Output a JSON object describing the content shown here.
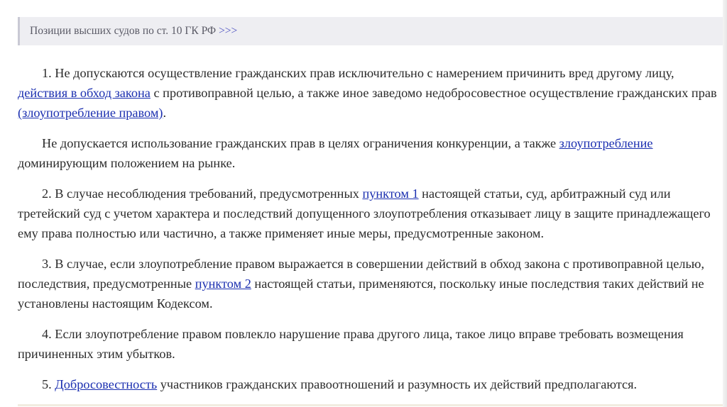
{
  "header": {
    "title": "Позиции высших судов по ст. 10 ГК РФ",
    "link": ">>>"
  },
  "paragraphs": [
    {
      "t1": "1. Не допускаются осуществление гражданских прав исключительно с намерением причинить вред другому лицу, ",
      "link1": "действия в обход закона",
      "t2": " с противоправной целью, а также иное заведомо недобросовестное осуществление гражданских прав ",
      "link2": "(злоупотребление правом)",
      "t3": "."
    },
    {
      "t1": "Не допускается использование гражданских прав в целях ограничения конкуренции, а также ",
      "link1": "злоупотребление",
      "t2": " доминирующим положением на рынке."
    },
    {
      "t1": "2. В случае несоблюдения требований, предусмотренных ",
      "link1": "пунктом 1",
      "t2": " настоящей статьи, суд, арбитражный суд или третейский суд с учетом характера и последствий допущенного злоупотребления отказывает лицу в защите принадлежащего ему права полностью или частично, а также применяет иные меры, предусмотренные законом."
    },
    {
      "t1": "3. В случае, если злоупотребление правом выражается в совершении действий в обход закона с противоправной целью, последствия, предусмотренные ",
      "link1": "пунктом 2",
      "t2": " настоящей статьи, применяются, поскольку иные последствия таких действий не установлены настоящим Кодексом."
    },
    {
      "t1": "4. Если злоупотребление правом повлекло нарушение права другого лица, такое лицо вправе требовать возмещения причиненных этим убытков."
    },
    {
      "t1": "5. ",
      "link1": "Добросовестность",
      "t2": " участников гражданских правоотношений и разумность их действий предполагаются."
    }
  ]
}
